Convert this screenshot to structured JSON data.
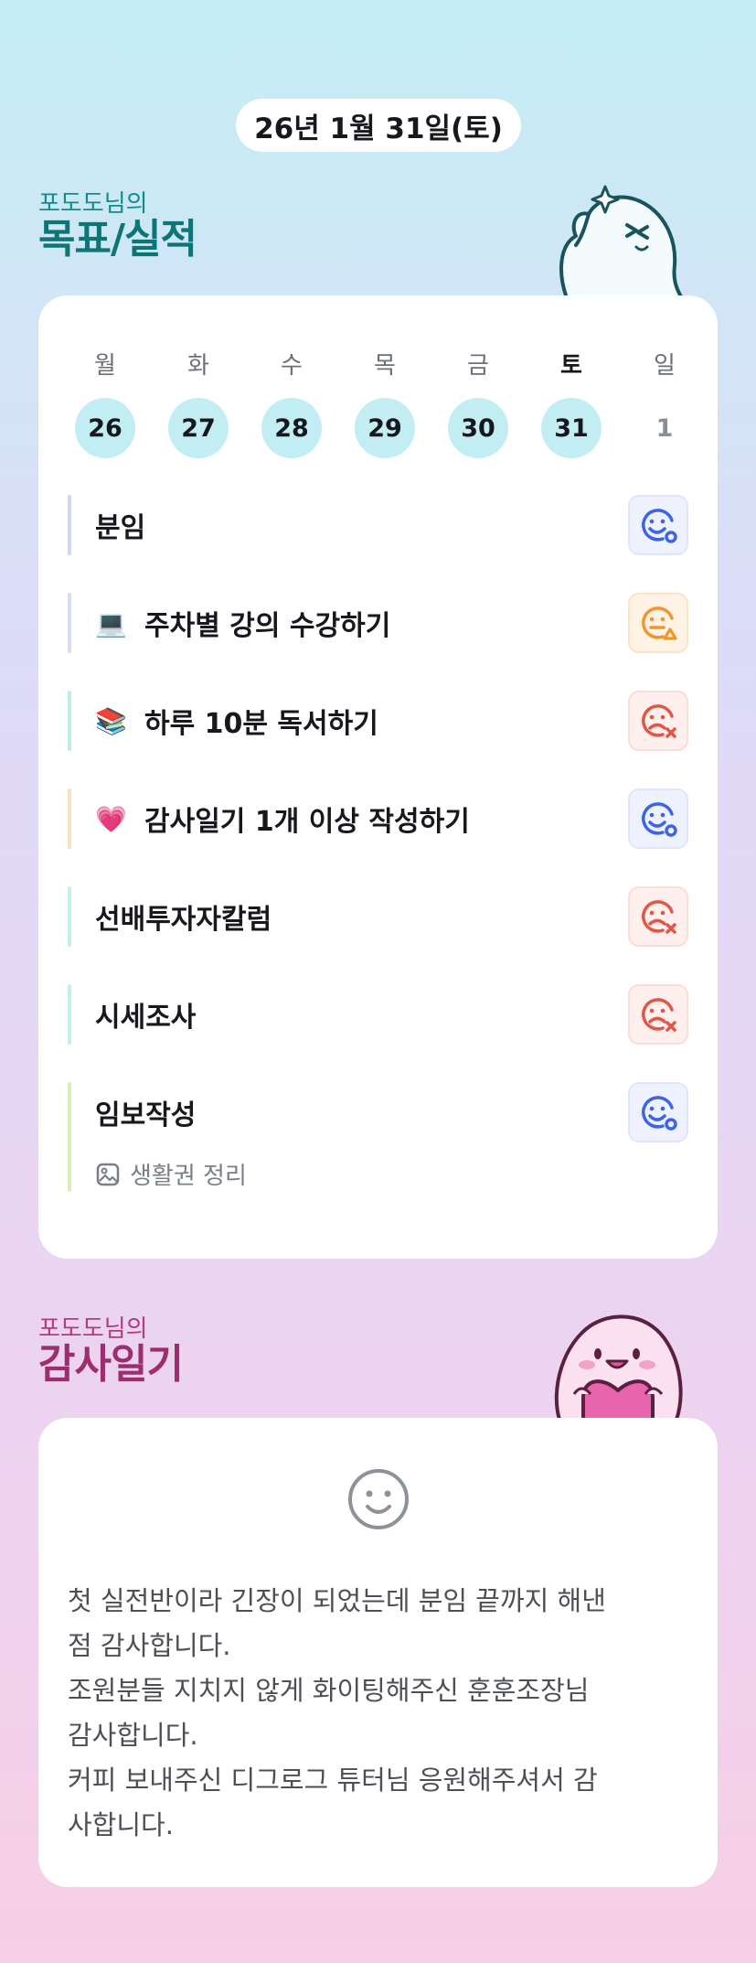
{
  "header": {
    "date": "26년 1월 31일(토)"
  },
  "goals_section": {
    "subtitle": "포도도님의",
    "title": "목표/실적"
  },
  "week": [
    {
      "name": "월",
      "date": "26",
      "marked": true,
      "today": false
    },
    {
      "name": "화",
      "date": "27",
      "marked": true,
      "today": false
    },
    {
      "name": "수",
      "date": "28",
      "marked": true,
      "today": false
    },
    {
      "name": "목",
      "date": "29",
      "marked": true,
      "today": false
    },
    {
      "name": "금",
      "date": "30",
      "marked": true,
      "today": false
    },
    {
      "name": "토",
      "date": "31",
      "marked": true,
      "today": true
    },
    {
      "name": "일",
      "date": "1",
      "marked": false,
      "today": false
    }
  ],
  "goals": [
    {
      "emoji": "",
      "label": "분임",
      "status": "good",
      "bar_color": "#cfd8f7"
    },
    {
      "emoji": "💻",
      "label": "주차별 강의 수강하기",
      "status": "mid",
      "bar_color": "#d6dcf7"
    },
    {
      "emoji": "📚",
      "label": "하루 10분 독서하기",
      "status": "bad",
      "bar_color": "#bfeedd"
    },
    {
      "emoji": "💗",
      "label": "감사일기 1개 이상 작성하기",
      "status": "good",
      "bar_color": "#fbe0c2"
    },
    {
      "emoji": "",
      "label": "선배투자자칼럼",
      "status": "bad",
      "bar_color": "#c5eef3"
    },
    {
      "emoji": "",
      "label": "시세조사",
      "status": "bad",
      "bar_color": "#c5eef3"
    },
    {
      "emoji": "",
      "label": "임보작성",
      "status": "good",
      "bar_color": "#d8f0b8",
      "note": "생활권 정리"
    }
  ],
  "gratitude_section": {
    "subtitle": "포도도님의",
    "title": "감사일기"
  },
  "gratitude": {
    "text": "첫 실전반이라 긴장이 되었는데 분임 끝까지 해낸\n점 감사합니다.\n조원분들 지치지 않게 화이팅해주신 훈훈조장님\n감사합니다.\n커피 보내주신 디그로그 튜터님 응원해주셔서 감\n사합니다."
  },
  "colors": {
    "goal_title": "#0e7576",
    "gratitude_title": "#9e2d6f",
    "status_good": "#3d63e6",
    "status_mid": "#f2962c",
    "status_bad": "#e2564a",
    "date_marked_bg": "#c2eef3"
  },
  "icons": {
    "status_good": "smile-circle-icon",
    "status_mid": "neutral-triangle-icon",
    "status_bad": "sad-x-icon",
    "note": "image-note-icon",
    "gratitude": "smile-face-icon"
  }
}
